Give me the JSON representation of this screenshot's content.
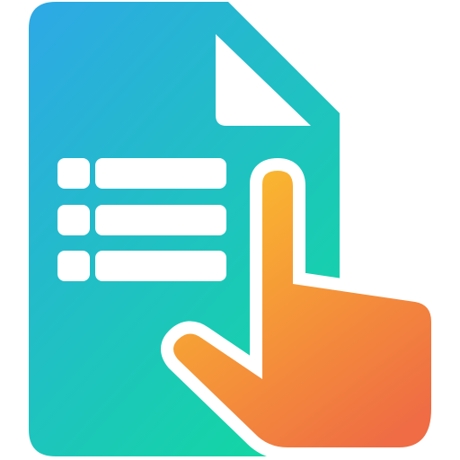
{
  "icon": {
    "name": "document-list-tap-icon",
    "colors": {
      "document_gradient_start": "#2EA8E6",
      "document_gradient_end": "#13D6A4",
      "hand_gradient_start": "#FBC02D",
      "hand_gradient_end": "#EF6C44",
      "foreground": "#FFFFFF"
    },
    "list_rows": 3
  }
}
